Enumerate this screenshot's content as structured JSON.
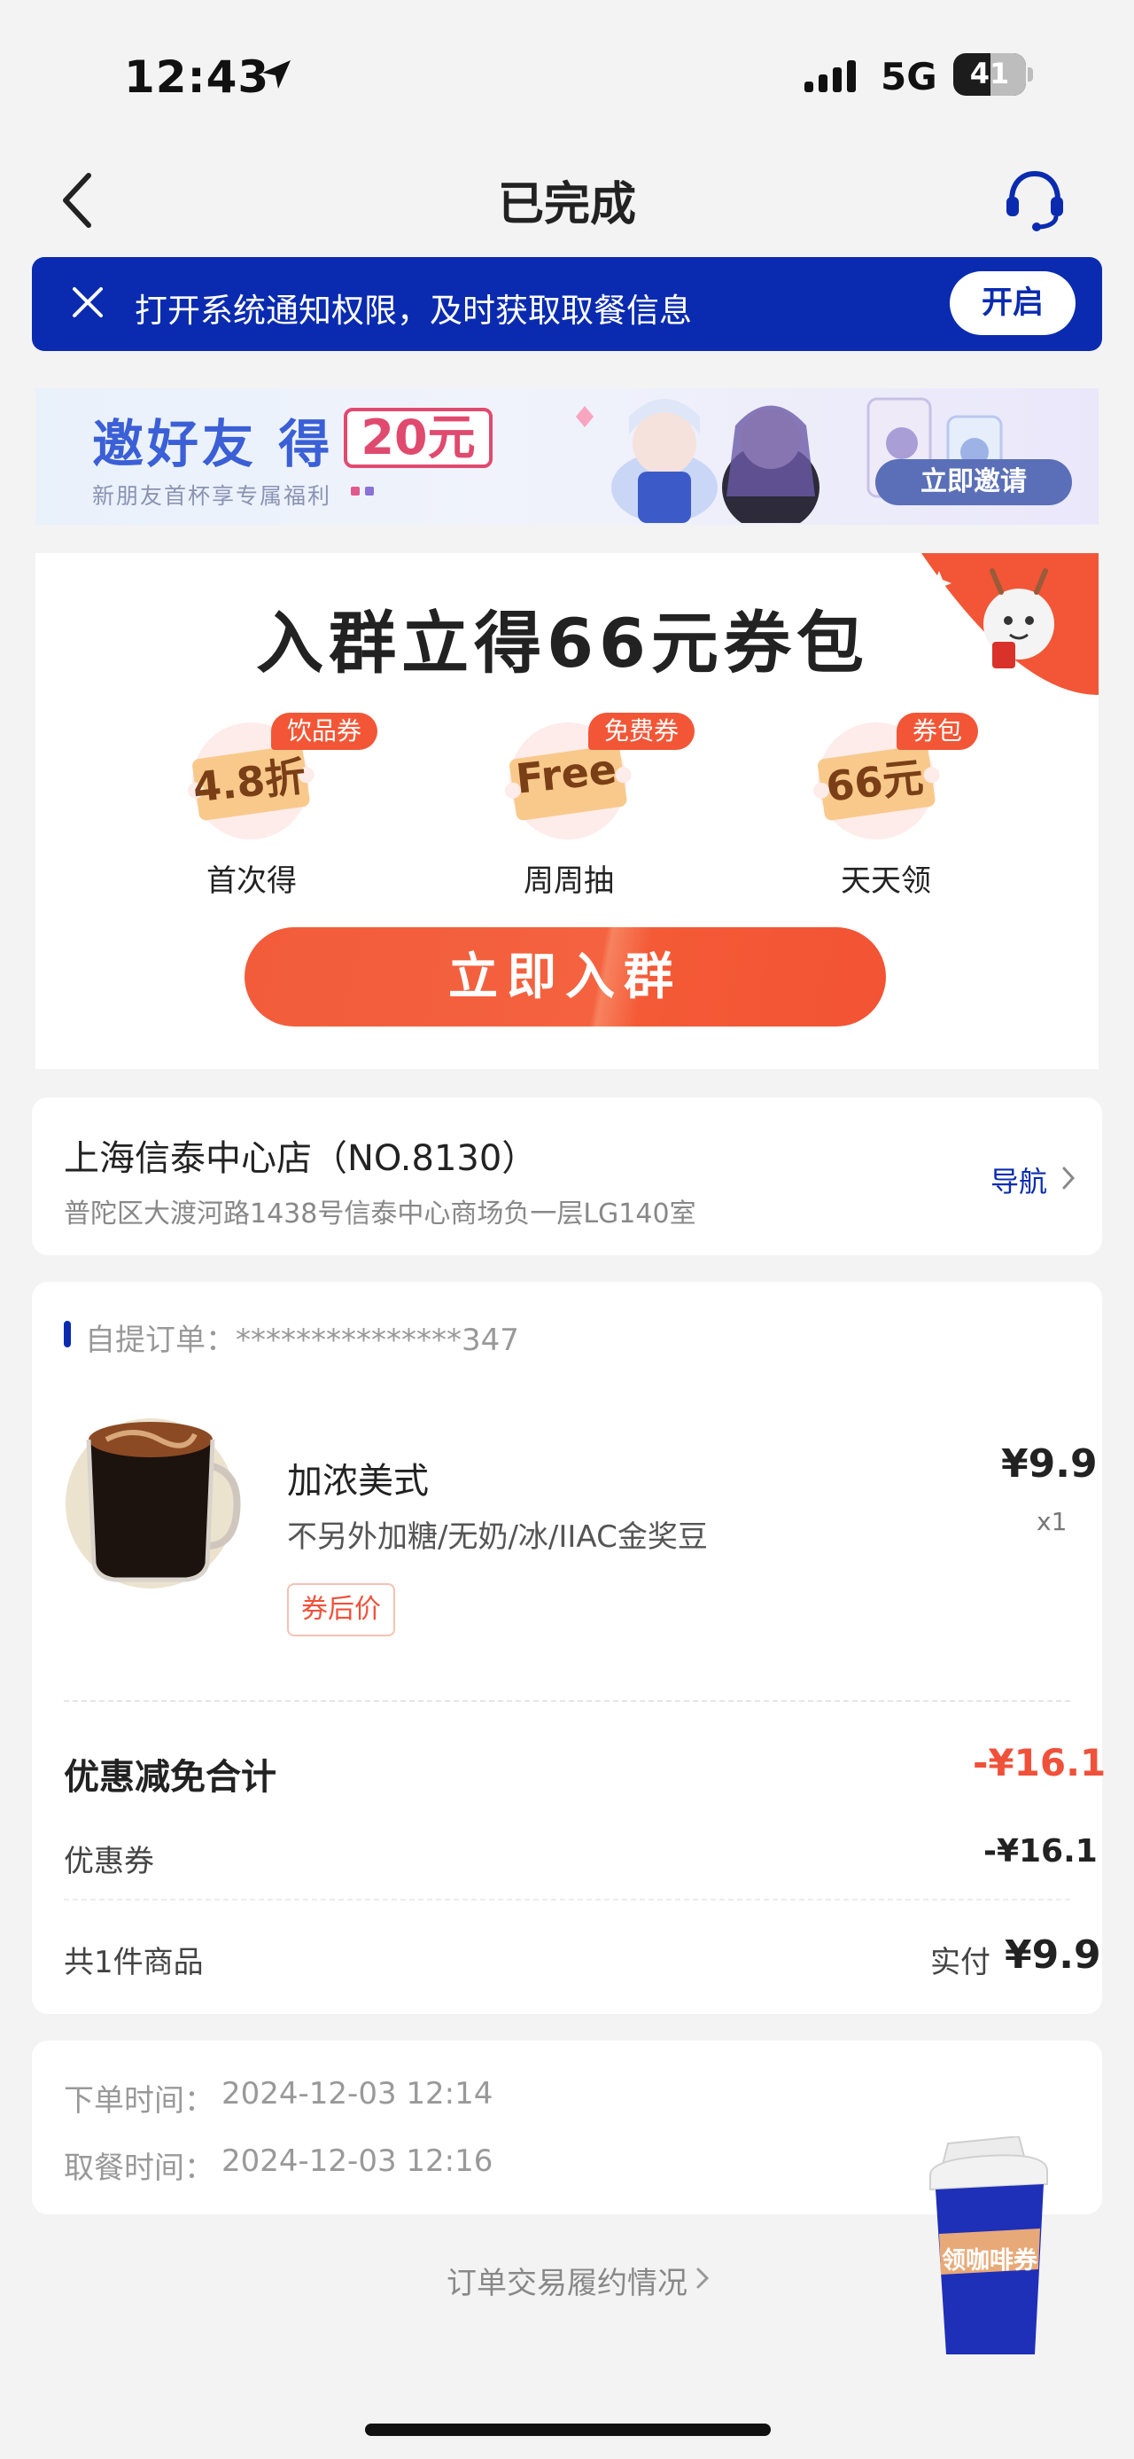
{
  "status_bar": {
    "time": "12:43",
    "network": "5G",
    "battery": "41"
  },
  "header": {
    "title": "已完成"
  },
  "notice": {
    "text": "打开系统通知权限，及时获取取餐信息",
    "button": "开启"
  },
  "invite_banner": {
    "title": "邀好友 得",
    "amount": "20元",
    "subtitle": "新朋友首杯享专属福利",
    "button": "立即邀请"
  },
  "group_card": {
    "title": "入群立得66元券包",
    "coupons": [
      {
        "tag": "饮品券",
        "face": "4.8折",
        "caption": "首次得"
      },
      {
        "tag": "免费券",
        "face": "Free",
        "caption": "周周抽"
      },
      {
        "tag": "券包",
        "face": "66元",
        "caption": "天天领"
      }
    ],
    "button": "立即入群"
  },
  "store": {
    "name": "上海信泰中心店（NO.8130）",
    "address": "普陀区大渡河路1438号信泰中心商场负一层LG140室",
    "nav": "导航"
  },
  "order": {
    "label": "自提订单：***************347",
    "product": {
      "name": "加浓美式",
      "spec": "不另外加糖/无奶/冰/IIAC金奖豆",
      "tag": "券后价",
      "price": "¥9.9",
      "qty": "x1"
    },
    "discount_label": "优惠减免合计",
    "discount_total": "-¥16.1",
    "coupon_label": "优惠券",
    "coupon_value": "-¥16.1",
    "count": "共1件商品",
    "paid_label": "实付",
    "paid_value": "¥9.9"
  },
  "times": {
    "order_label": "下单时间：",
    "order_time": "2024-12-03 12:14",
    "pickup_label": "取餐时间：",
    "pickup_time": "2024-12-03 12:16"
  },
  "fulfilment_link": "订单交易履约情况",
  "float_button": "领咖啡券",
  "colors": {
    "brand_blue": "#0a2bb0",
    "accent_orange": "#f25636",
    "price_red": "#f0513a"
  }
}
